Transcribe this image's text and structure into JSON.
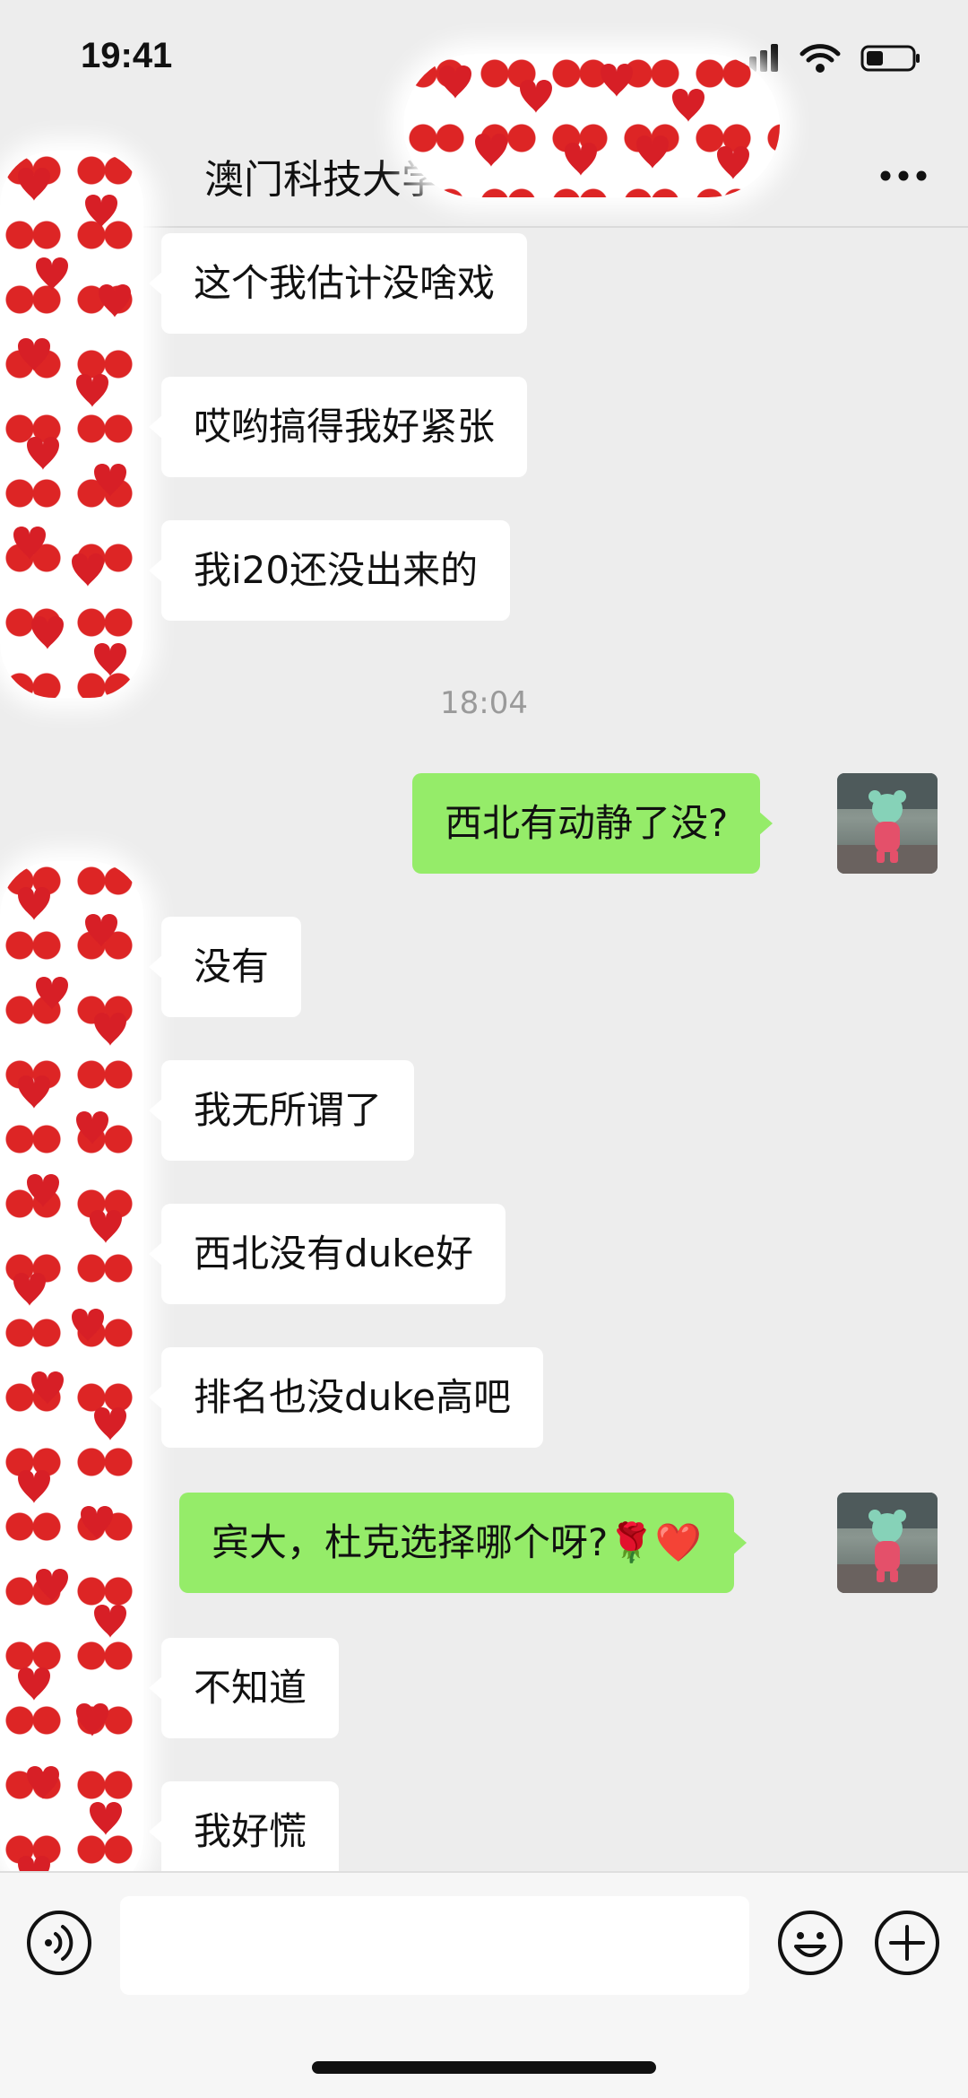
{
  "status_bar": {
    "time": "19:41"
  },
  "nav": {
    "title": "澳门科技大学"
  },
  "chat": {
    "messages": [
      {
        "side": "in",
        "text": "这个我估计没啥戏"
      },
      {
        "side": "in",
        "text": "哎哟搞得我好紧张"
      },
      {
        "side": "in",
        "text": "我i20还没出来的"
      },
      {
        "side": "out",
        "text": "西北有动静了没?"
      },
      {
        "side": "in",
        "text": "没有"
      },
      {
        "side": "in",
        "text": "我无所谓了"
      },
      {
        "side": "in",
        "text": "西北没有duke好"
      },
      {
        "side": "in",
        "text": "排名也没duke高吧"
      },
      {
        "side": "out",
        "text": "宾大，杜克选择哪个呀?",
        "emojis": "🌹❤️"
      },
      {
        "side": "in",
        "text": "不知道"
      },
      {
        "side": "in",
        "text": "我好慌"
      }
    ],
    "timestamp": "18:04"
  },
  "icons": {
    "back": "back-arrow-icon",
    "more": "more-dots-icon",
    "voice": "voice-icon",
    "emoji": "emoji-icon",
    "plus": "plus-icon",
    "signal": "signal-icon",
    "wifi": "wifi-icon",
    "battery": "battery-icon",
    "rose": "rose-icon",
    "heart": "heart-icon",
    "avatar": "bear-avatar-icon"
  },
  "colors": {
    "background": "#ededed",
    "incoming_bubble": "#ffffff",
    "outgoing_bubble": "#95ec69",
    "hearts": "#d71f26"
  }
}
